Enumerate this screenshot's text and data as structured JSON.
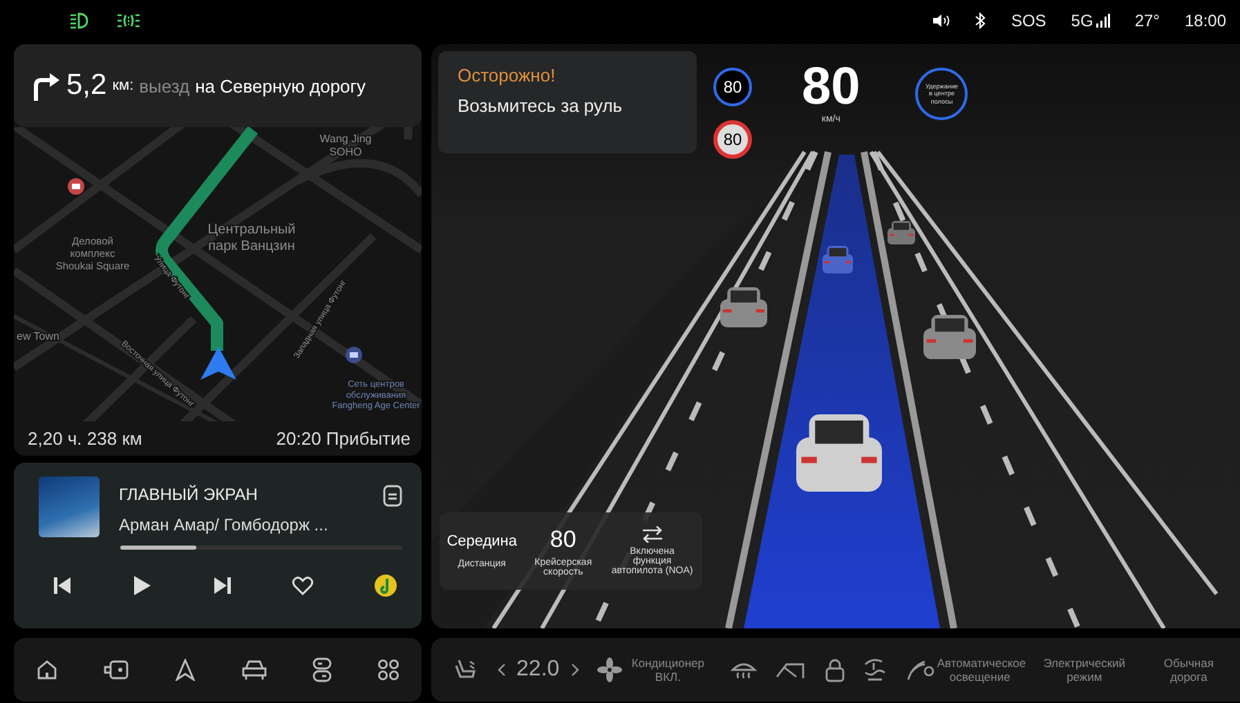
{
  "status_bar": {
    "sos": "SOS",
    "network": "5G",
    "temperature": "27°",
    "time": "18:00"
  },
  "navigation": {
    "distance": "5,2",
    "unit": "км:",
    "action": "выезд",
    "road": "на Северную дорогу",
    "remaining": "2,20 ч. 238 км",
    "arrival": "20:20 Прибытие",
    "map_labels": [
      {
        "lines": [
          "Wang Jing",
          "SOHO"
        ]
      },
      {
        "lines": [
          "Центральный",
          "парк Ванцзин"
        ]
      },
      {
        "lines": [
          "Деловой",
          "комплекс",
          "Shoukai Square"
        ]
      },
      {
        "lines": [
          "Улица Футонг"
        ]
      },
      {
        "lines": [
          "Западная улица Футонг"
        ]
      },
      {
        "lines": [
          "Восточная улица Футонг"
        ]
      },
      {
        "lines": [
          "ew Town"
        ]
      },
      {
        "lines": [
          "Сеть центров",
          "обслуживания",
          "Fangheng Age Center"
        ]
      }
    ]
  },
  "media": {
    "title": "ГЛАВНЫЙ ЭКРАН",
    "artist": "Арман Амар/ Гомбодорж ...",
    "level": 0.27
  },
  "adas": {
    "warning": {
      "title": "Осторожно!",
      "message": "Возьмитесь за руль"
    },
    "signs": [
      {
        "kind": "detected",
        "value": "80"
      },
      {
        "kind": "limit",
        "value": "80"
      }
    ],
    "speed": "80",
    "speed_unit": "км/ч",
    "lane_keep": [
      "Удержание",
      "в центре",
      "полосы"
    ],
    "info": [
      {
        "kind": "value",
        "value": "Середина",
        "label": "Дистанция"
      },
      {
        "kind": "value",
        "value": "80",
        "label": "Крейсерская скорость"
      },
      {
        "kind": "icon",
        "label": "Включена функция автопилота (NOA)"
      }
    ]
  },
  "climate": {
    "temperature": "22.0",
    "ac_label": "Кондиционер ВКЛ.",
    "light_label": "Автоматическое освещение",
    "modes": [
      "Электрический режим",
      "Обычная дорога"
    ]
  }
}
